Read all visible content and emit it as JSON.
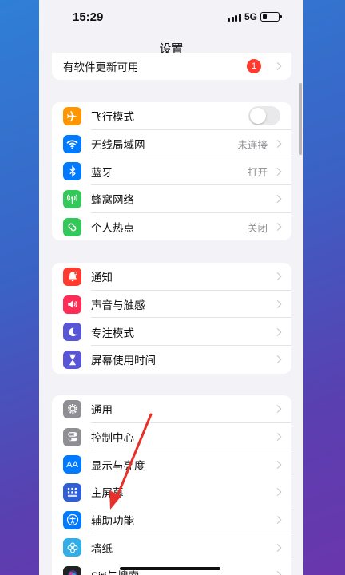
{
  "status_bar": {
    "time": "15:29",
    "network": "5G"
  },
  "nav": {
    "title": "设置"
  },
  "update_row": {
    "label": "有软件更新可用",
    "badge": "1"
  },
  "group1": [
    {
      "label": "飞行模式",
      "value": "",
      "icon": "airplane-icon",
      "color": "#ff9500",
      "toggle": true
    },
    {
      "label": "无线局域网",
      "value": "未连接",
      "icon": "wifi-icon",
      "color": "#007aff"
    },
    {
      "label": "蓝牙",
      "value": "打开",
      "icon": "bluetooth-icon",
      "color": "#007aff"
    },
    {
      "label": "蜂窝网络",
      "value": "",
      "icon": "antenna-icon",
      "color": "#34c759"
    },
    {
      "label": "个人热点",
      "value": "关闭",
      "icon": "hotspot-icon",
      "color": "#34c759"
    }
  ],
  "group2": [
    {
      "label": "通知",
      "icon": "bell-icon",
      "color": "#ff3b30"
    },
    {
      "label": "声音与触感",
      "icon": "speaker-icon",
      "color": "#ff2d55"
    },
    {
      "label": "专注模式",
      "icon": "moon-icon",
      "color": "#5856d6"
    },
    {
      "label": "屏幕使用时间",
      "icon": "hourglass-icon",
      "color": "#5856d6"
    }
  ],
  "group3": [
    {
      "label": "通用",
      "icon": "gear-icon",
      "color": "#8e8e93"
    },
    {
      "label": "控制中心",
      "icon": "toggles-icon",
      "color": "#8e8e93"
    },
    {
      "label": "显示与亮度",
      "icon": "text-size-icon",
      "color": "#007aff",
      "glyph": "AA"
    },
    {
      "label": "主屏幕",
      "icon": "grid-icon",
      "color": "#2f5fd6"
    },
    {
      "label": "辅助功能",
      "icon": "accessibility-icon",
      "color": "#007aff"
    },
    {
      "label": "墙纸",
      "icon": "flower-icon",
      "color": "#32ade6"
    },
    {
      "label": "Siri与搜索",
      "icon": "siri-icon",
      "color": "#222222"
    }
  ],
  "annotation": {
    "color": "#e8302a"
  }
}
